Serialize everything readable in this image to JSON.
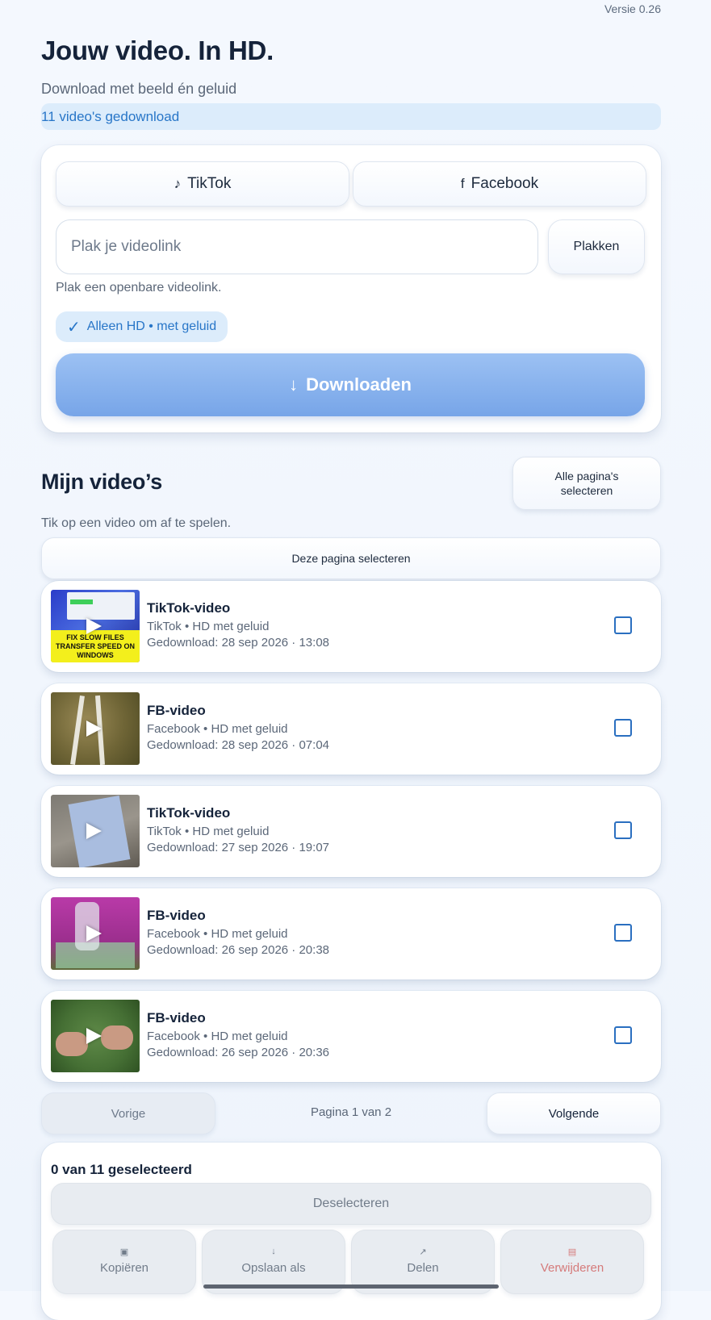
{
  "version": "Versie 0.26",
  "header": {
    "title": "Jouw video. In HD.",
    "subtitle": "Download met beeld én geluid",
    "download_count": "11 video's gedownload"
  },
  "source_tabs": [
    {
      "icon": "♪",
      "label": "TikTok"
    },
    {
      "icon": "f",
      "label": "Facebook"
    }
  ],
  "link_input": {
    "placeholder": "Plak je videolink",
    "value": ""
  },
  "paste_label": "Plakken",
  "input_hint": "Plak een openbare videolink.",
  "quality_chip": {
    "check": "✓",
    "label": "Alleen HD • met geluid"
  },
  "download_button": {
    "icon": "↓",
    "label": "Downloaden"
  },
  "my_videos": {
    "title": "Mijn video’s",
    "select_all_pages": "Alle pagina's selecteren",
    "tap_hint": "Tik op een video om af te spelen.",
    "select_page": "Deze pagina selecteren"
  },
  "videos": [
    {
      "title": "TikTok-video",
      "meta": "TikTok • HD met geluid",
      "date": "Gedownload: 28 sep 2026 · 13:08",
      "thumb_text": "FIX SLOW FILES TRANSFER SPEED ON WINDOWS"
    },
    {
      "title": "FB-video",
      "meta": "Facebook • HD met geluid",
      "date": "Gedownload: 28 sep 2026 · 07:04"
    },
    {
      "title": "TikTok-video",
      "meta": "TikTok • HD met geluid",
      "date": "Gedownload: 27 sep 2026 · 19:07"
    },
    {
      "title": "FB-video",
      "meta": "Facebook • HD met geluid",
      "date": "Gedownload: 26 sep 2026 · 20:38"
    },
    {
      "title": "FB-video",
      "meta": "Facebook • HD met geluid",
      "date": "Gedownload: 26 sep 2026 · 20:36"
    }
  ],
  "pagination": {
    "prev": "Vorige",
    "info": "Pagina 1 van 2",
    "next": "Volgende"
  },
  "selection": {
    "count": "0 van 11 geselecteerd",
    "deselect": "Deselecteren",
    "actions": [
      {
        "icon": "▣",
        "label": "Kopiëren"
      },
      {
        "icon": "↓",
        "label": "Opslaan als"
      },
      {
        "icon": "↗",
        "label": "Delen"
      },
      {
        "icon": "▤",
        "label": "Verwijderen"
      }
    ]
  },
  "colors": {
    "accent": "#2876c8",
    "download_button": "#77a5e8",
    "danger": "#d57b7b",
    "title": "#15233a"
  }
}
